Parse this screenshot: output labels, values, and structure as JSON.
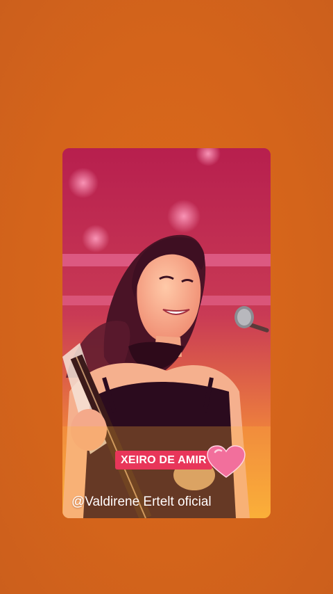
{
  "story": {
    "background_color": "#d5661a",
    "sticker_label": "XEIRO DE AMIR",
    "sticker_color": "#e8365a",
    "heart_icon": "heart-icon",
    "heart_color": "#f06a9a",
    "credit": "@Valdirene Ertelt oficial"
  }
}
